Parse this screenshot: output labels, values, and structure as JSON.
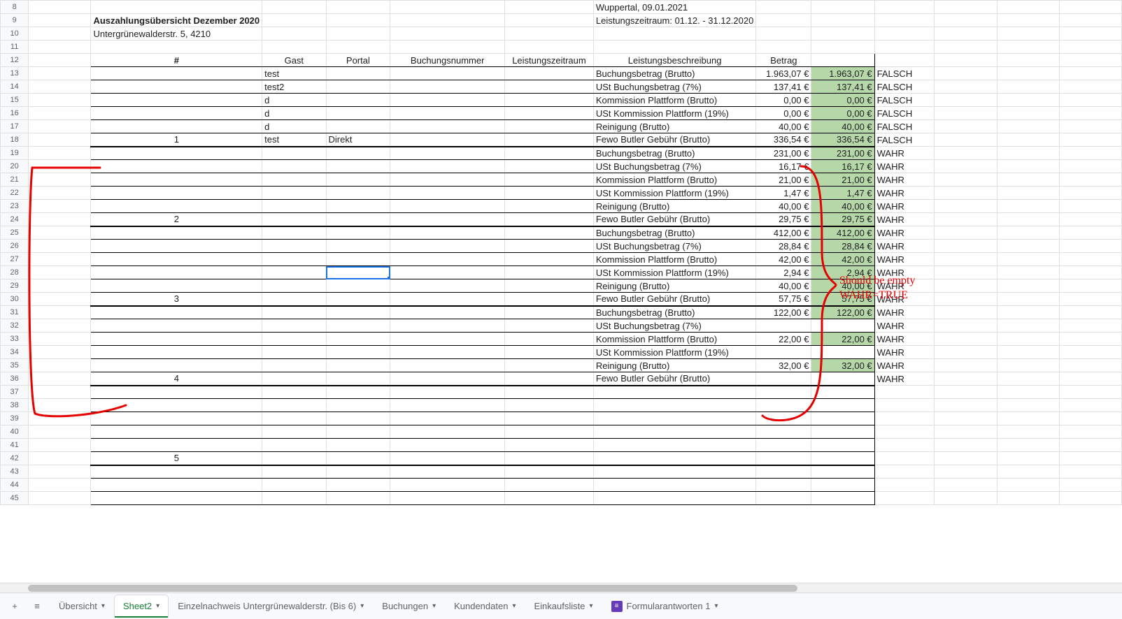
{
  "meta": {
    "location_date": "Wuppertal, 09.01.2021",
    "period": "Leistungszeitraum: 01.12. - 31.12.2020",
    "title": "Auszahlungsübersicht Dezember 2020",
    "address": "Untergrünewalderstr. 5, 4210"
  },
  "headers": {
    "num": "#",
    "gast": "Gast",
    "portal": "Portal",
    "buchungsnummer": "Buchungsnummer",
    "leistungszeitraum": "Leistungszeitraum",
    "beschreibung": "Leistungsbeschreibung",
    "betrag": "Betrag"
  },
  "rows": [
    {
      "r": 13,
      "gast": "test",
      "desc": "Buchungsbetrag (Brutto)",
      "h": "1.963,07 €",
      "i": "1.963,07 €",
      "j": "FALSCH"
    },
    {
      "r": 14,
      "gast": "test2",
      "desc": "USt Buchungsbetrag (7%)",
      "h": "137,41 €",
      "i": "137,41 €",
      "j": "FALSCH"
    },
    {
      "r": 15,
      "gast": "d",
      "desc": "Kommission Plattform (Brutto)",
      "h": "0,00 €",
      "i": "0,00 €",
      "j": "FALSCH"
    },
    {
      "r": 16,
      "gast": "d",
      "desc": "USt Kommission Plattform (19%)",
      "h": "0,00 €",
      "i": "0,00 €",
      "j": "FALSCH"
    },
    {
      "r": 17,
      "gast": "d",
      "desc": "Reinigung (Brutto)",
      "h": "40,00 €",
      "i": "40,00 €",
      "j": "FALSCH"
    },
    {
      "r": 18,
      "num": "1",
      "gast": "test",
      "portal": "Direkt",
      "desc": "Fewo Butler Gebühr (Brutto)",
      "h": "336,54 €",
      "i": "336,54 €",
      "j": "FALSCH",
      "thick": true
    },
    {
      "r": 19,
      "desc": "Buchungsbetrag (Brutto)",
      "h": "231,00 €",
      "i": "231,00 €",
      "j": "WAHR"
    },
    {
      "r": 20,
      "desc": "USt Buchungsbetrag (7%)",
      "h": "16,17 €",
      "i": "16,17 €",
      "j": "WAHR"
    },
    {
      "r": 21,
      "desc": "Kommission Plattform (Brutto)",
      "h": "21,00 €",
      "i": "21,00 €",
      "j": "WAHR"
    },
    {
      "r": 22,
      "desc": "USt Kommission Plattform (19%)",
      "h": "1,47 €",
      "i": "1,47 €",
      "j": "WAHR"
    },
    {
      "r": 23,
      "desc": "Reinigung (Brutto)",
      "h": "40,00 €",
      "i": "40,00 €",
      "j": "WAHR"
    },
    {
      "r": 24,
      "num": "2",
      "desc": "Fewo Butler Gebühr (Brutto)",
      "h": "29,75 €",
      "i": "29,75 €",
      "j": "WAHR",
      "thick": true
    },
    {
      "r": 25,
      "desc": "Buchungsbetrag (Brutto)",
      "h": "412,00 €",
      "i": "412,00 €",
      "j": "WAHR"
    },
    {
      "r": 26,
      "desc": "USt Buchungsbetrag (7%)",
      "h": "28,84 €",
      "i": "28,84 €",
      "j": "WAHR"
    },
    {
      "r": 27,
      "desc": "Kommission Plattform (Brutto)",
      "h": "42,00 €",
      "i": "42,00 €",
      "j": "WAHR"
    },
    {
      "r": 28,
      "desc": "USt Kommission Plattform (19%)",
      "h": "2,94 €",
      "i": "2,94 €",
      "j": "WAHR"
    },
    {
      "r": 29,
      "desc": "Reinigung (Brutto)",
      "h": "40,00 €",
      "i": "40,00 €",
      "j": "WAHR"
    },
    {
      "r": 30,
      "num": "3",
      "desc": "Fewo Butler Gebühr (Brutto)",
      "h": "57,75 €",
      "i": "57,75 €",
      "j": "WAHR",
      "thick": true
    },
    {
      "r": 31,
      "desc": "Buchungsbetrag (Brutto)",
      "h": "122,00 €",
      "i": "122,00 €",
      "j": "WAHR"
    },
    {
      "r": 32,
      "desc": "USt Buchungsbetrag (7%)",
      "h": "",
      "i": "",
      "j": "WAHR"
    },
    {
      "r": 33,
      "desc": "Kommission Plattform (Brutto)",
      "h": "22,00 €",
      "i": "22,00 €",
      "j": "WAHR"
    },
    {
      "r": 34,
      "desc": "USt Kommission Plattform (19%)",
      "h": "",
      "i": "",
      "j": "WAHR"
    },
    {
      "r": 35,
      "desc": "Reinigung (Brutto)",
      "h": "32,00 €",
      "i": "32,00 €",
      "j": "WAHR"
    },
    {
      "r": 36,
      "num": "4",
      "desc": "Fewo Butler Gebühr (Brutto)",
      "h": "",
      "i": "",
      "j": "WAHR",
      "thick": true
    },
    {
      "r": 37
    },
    {
      "r": 38
    },
    {
      "r": 39
    },
    {
      "r": 40
    },
    {
      "r": 41
    },
    {
      "r": 42,
      "num": "5",
      "thick": true
    },
    {
      "r": 43
    },
    {
      "r": 44
    },
    {
      "r": 45
    }
  ],
  "row_start": 8,
  "row_end": 45,
  "selected_cell": "D28",
  "annotation": {
    "line1": "Should be empty",
    "line2": "WAHR=TRUE"
  },
  "tabs": {
    "add": "+",
    "list_icon": "≡",
    "items": [
      {
        "label": "Übersicht",
        "active": false
      },
      {
        "label": "Sheet2",
        "active": true
      },
      {
        "label": "Einzelnachweis Untergrünewalderstr. (Bis 6)",
        "active": false
      },
      {
        "label": "Buchungen",
        "active": false
      },
      {
        "label": "Kundendaten",
        "active": false
      },
      {
        "label": "Einkaufsliste",
        "active": false
      },
      {
        "label": "Formularantworten 1",
        "active": false,
        "form": true
      }
    ]
  }
}
